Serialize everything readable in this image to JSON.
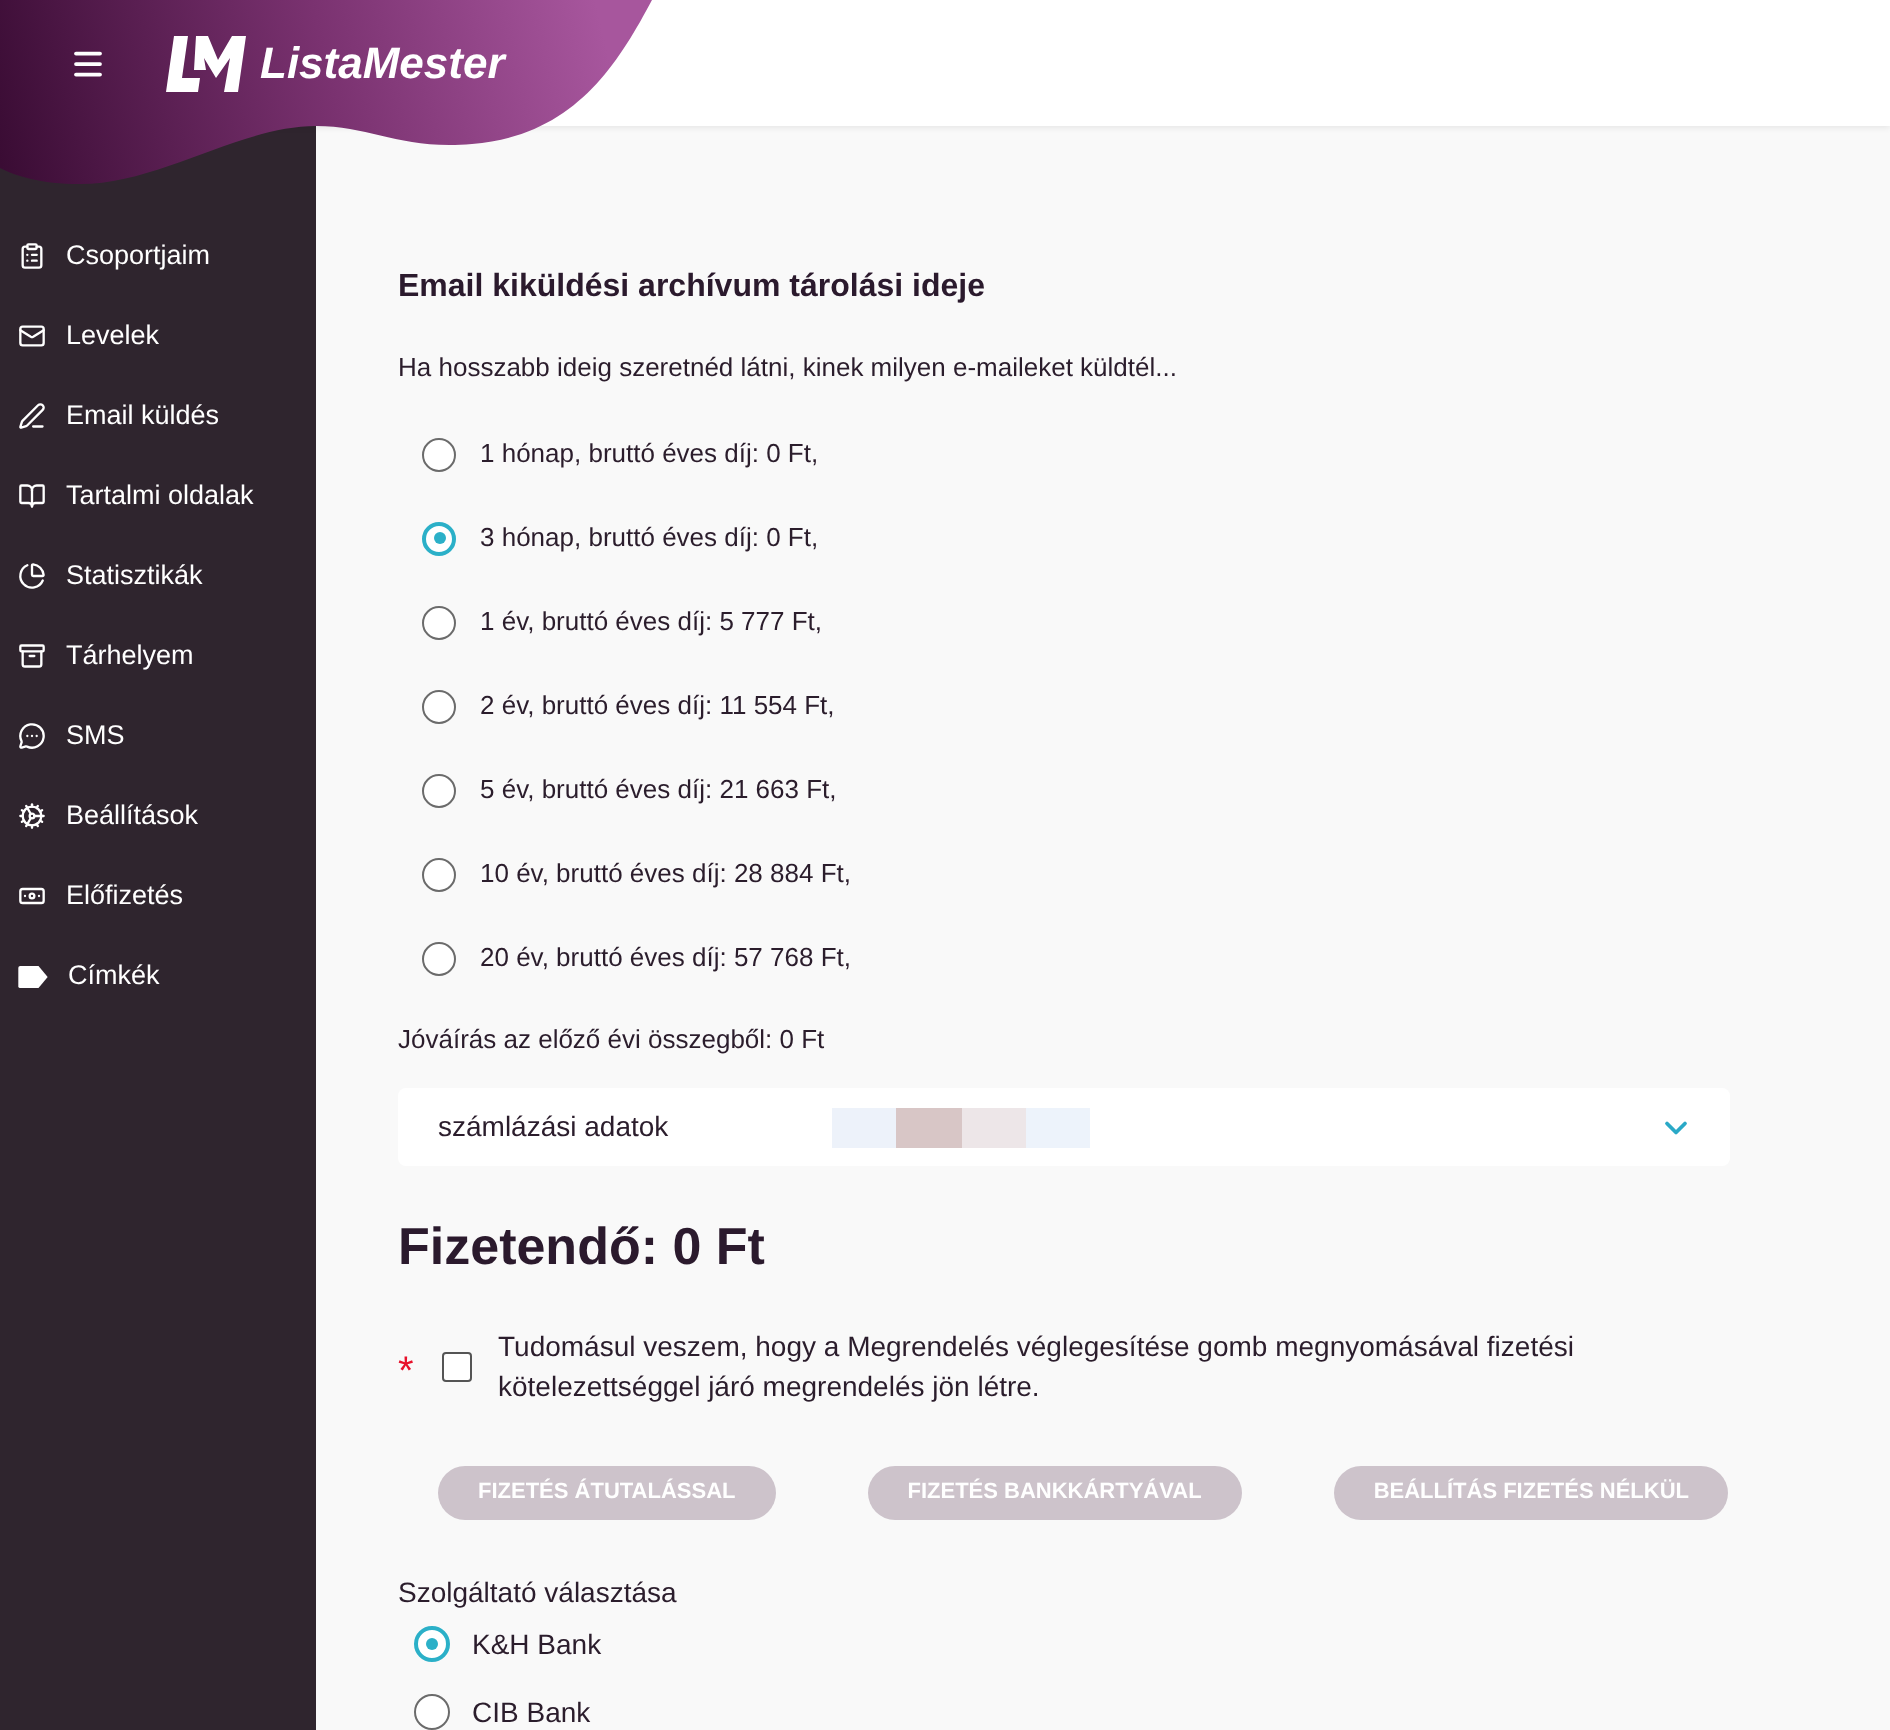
{
  "header": {
    "brand": "ListaMester"
  },
  "sidebar": {
    "items": [
      {
        "label": "Csoportjaim"
      },
      {
        "label": "Levelek"
      },
      {
        "label": "Email küldés"
      },
      {
        "label": "Tartalmi oldalak"
      },
      {
        "label": "Statisztikák"
      },
      {
        "label": "Tárhelyem"
      },
      {
        "label": "SMS"
      },
      {
        "label": "Beállítások"
      },
      {
        "label": "Előfizetés"
      },
      {
        "label": "Címkék"
      }
    ]
  },
  "archive": {
    "title": "Email kiküldési archívum tárolási ideje",
    "description": "Ha hosszabb ideig szeretnéd látni, kinek milyen e-maileket küldtél...",
    "options": [
      {
        "label": "1 hónap, bruttó éves díj: 0 Ft,",
        "selected": false
      },
      {
        "label": "3 hónap, bruttó éves díj: 0 Ft,",
        "selected": true
      },
      {
        "label": "1 év, bruttó éves díj: 5 777 Ft,",
        "selected": false
      },
      {
        "label": "2 év, bruttó éves díj: 11 554 Ft,",
        "selected": false
      },
      {
        "label": "5 év, bruttó éves díj: 21 663 Ft,",
        "selected": false
      },
      {
        "label": "10 év, bruttó éves díj: 28 884 Ft,",
        "selected": false
      },
      {
        "label": "20 év, bruttó éves díj: 57 768 Ft,",
        "selected": false
      }
    ],
    "credit": "Jóváírás az előző évi összegből: 0 Ft"
  },
  "billing": {
    "label": "számlázási adatok",
    "expanded": false
  },
  "total": "Fizetendő: 0 Ft",
  "consent": {
    "required_mark": "*",
    "checked": false,
    "text": "Tudomásul veszem, hogy a Megrendelés véglegesítése gomb megnyomásával fizetési kötelezettséggel járó megrendelés jön létre."
  },
  "payment_buttons": [
    {
      "label": "FIZETÉS ÁTUTALÁSSAL",
      "disabled": true
    },
    {
      "label": "FIZETÉS BANKKÁRTYÁVAL",
      "disabled": true
    },
    {
      "label": "BEÁLLÍTÁS FIZETÉS NÉLKÜL",
      "disabled": true
    }
  ],
  "provider": {
    "label": "Szolgáltató választása",
    "options": [
      {
        "label": "K&H Bank",
        "selected": true
      },
      {
        "label": "CIB Bank",
        "selected": false
      }
    ]
  }
}
